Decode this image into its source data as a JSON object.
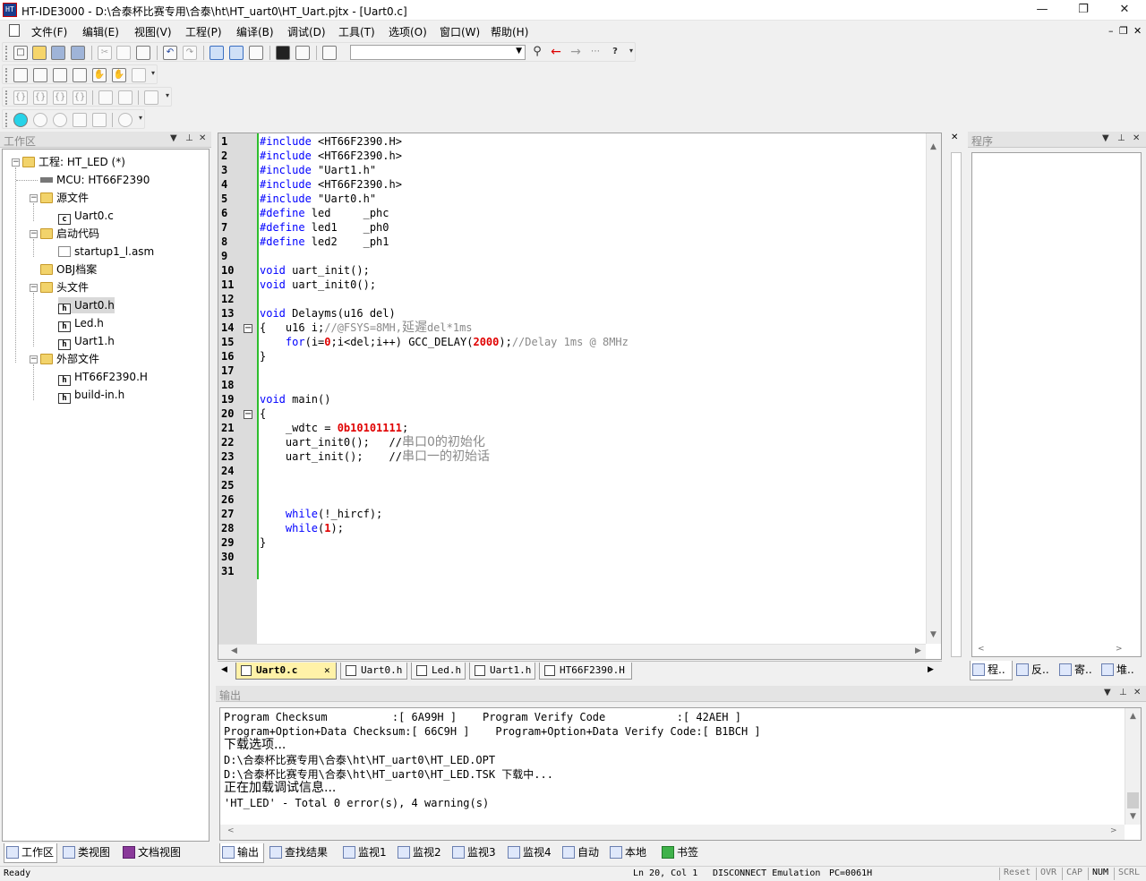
{
  "titlebar": {
    "title": "HT-IDE3000 - D:\\合泰杯比赛专用\\合泰\\ht\\HT_uart0\\HT_Uart.pjtx - [Uart0.c]",
    "icon_text": "HT",
    "minimize": "—",
    "restore": "❐",
    "close": "✕"
  },
  "menubar": {
    "items": [
      "文件(F)",
      "编辑(E)",
      "视图(V)",
      "工程(P)",
      "编译(B)",
      "调试(D)",
      "工具(T)",
      "选项(O)",
      "窗口(W)",
      "帮助(H)"
    ],
    "mdi_controls": [
      "–",
      "❐",
      "✕"
    ]
  },
  "workspace": {
    "header": "工作区",
    "tree": [
      {
        "label": "工程: HT_LED (*)",
        "icon": "project-icon"
      },
      {
        "label": "MCU: HT66F2390",
        "icon": "chip-icon"
      },
      {
        "label": "源文件",
        "icon": "folder-icon"
      },
      {
        "label": "Uart0.c",
        "icon": "c-file-icon"
      },
      {
        "label": "启动代码",
        "icon": "folder-icon"
      },
      {
        "label": "startup1_l.asm",
        "icon": "asm-file-icon"
      },
      {
        "label": "OBJ档案",
        "icon": "folder-icon"
      },
      {
        "label": "头文件",
        "icon": "folder-icon"
      },
      {
        "label": "Uart0.h",
        "icon": "h-file-icon"
      },
      {
        "label": "Led.h",
        "icon": "h-file-icon"
      },
      {
        "label": "Uart1.h",
        "icon": "h-file-icon"
      },
      {
        "label": "外部文件",
        "icon": "folder-icon"
      },
      {
        "label": "HT66F2390.H",
        "icon": "h-file-icon"
      },
      {
        "label": "build-in.h",
        "icon": "h-file-icon"
      }
    ],
    "bottom_tabs": [
      "工作区",
      "类视图",
      "文档视图"
    ]
  },
  "editor": {
    "line_numbers": [
      "1",
      "2",
      "3",
      "4",
      "5",
      "6",
      "7",
      "8",
      "9",
      "10",
      "11",
      "12",
      "13",
      "14",
      "15",
      "16",
      "17",
      "18",
      "19",
      "20",
      "21",
      "22",
      "23",
      "24",
      "25",
      "26",
      "27",
      "28",
      "29",
      "30",
      "31"
    ],
    "tabs": [
      "Uart0.c",
      "Uart0.h",
      "Led.h",
      "Uart1.h",
      "HT66F2390.H"
    ],
    "active_tab": "Uart0.c",
    "code": {
      "l1_kw": "#include",
      "l1_rest": " <HT66F2390.H>",
      "l2_kw": "#include",
      "l2_rest": " <HT66F2390.h>",
      "l3_kw": "#include",
      "l3_rest": " \"Uart1.h\"",
      "l4_kw": "#include",
      "l4_rest": " <HT66F2390.h>",
      "l5_kw": "#include",
      "l5_rest": " \"Uart0.h\"",
      "l6_kw": "#define",
      "l6_rest": " led     _phc",
      "l7_kw": "#define",
      "l7_rest": " led1    _ph0",
      "l8_kw": "#define",
      "l8_rest": " led2    _ph1",
      "l10_kw": "void",
      "l10_rest": " uart_init();",
      "l11_kw": "void",
      "l11_rest": " uart_init0();",
      "l13_kw": "void",
      "l13_rest": " Delayms(u16 del)",
      "l14_pre": "{   u16 i;",
      "l14_cmt": "//@FSYS=8MH,",
      "l14_cmt_cn": "延遲",
      "l14_cmt2": "del*1ms",
      "l15_indent": "    ",
      "l15_kw": "for",
      "l15_a": "(i=",
      "l15_n1": "0",
      "l15_b": ";i<del;i++) GCC_DELAY(",
      "l15_n2": "2000",
      "l15_c": ");",
      "l15_cmt": "//Delay 1ms @ 8MHz",
      "l16": "}",
      "l19_kw": "void",
      "l19_rest": " main()",
      "l20": "{",
      "l21_pre": "    _wdtc = ",
      "l21_num": "0b10101111",
      "l21_post": ";",
      "l22_pre": "    uart_init0();   //",
      "l22_cn": "串口0的初始化",
      "l23_pre": "    uart_init();    //",
      "l23_cn": "串口一的初始话",
      "l27_indent": "    ",
      "l27_kw": "while",
      "l27_rest": "(!_hircf);",
      "l28_indent": "    ",
      "l28_kw": "while",
      "l28_a": "(",
      "l28_num": "1",
      "l28_b": ");",
      "l29": "}"
    }
  },
  "right_panel": {
    "header": "程序",
    "tabs": [
      "程..",
      "反..",
      "寄..",
      "堆.."
    ]
  },
  "output": {
    "header": "输出",
    "lines": [
      {
        "text": "Program Checksum          :[ 6A99H ]    Program Verify Code           :[ 42AEH ]"
      },
      {
        "text": "Program+Option+Data Checksum:[ 66C9H ]    Program+Option+Data Verify Code:[ B1BCH ]"
      },
      {
        "text": "下载选项..."
      },
      {
        "text": "D:\\合泰杯比赛专用\\合泰\\ht\\HT_uart0\\HT_LED.OPT"
      },
      {
        "text": "D:\\合泰杯比赛专用\\合泰\\ht\\HT_uart0\\HT_LED.TSK 下载中..."
      },
      {
        "text": "正在加载调试信息..."
      },
      {
        "text": "'HT_LED' - Total 0 error(s), 4 warning(s)"
      }
    ],
    "tabs": [
      "输出",
      "查找结果",
      "监视1",
      "监视2",
      "监视3",
      "监视4",
      "自动",
      "本地",
      "书签"
    ]
  },
  "statusbar": {
    "ready": "Ready",
    "position": "Ln 20, Col 1",
    "mode": "DISCONNECT Emulation",
    "pc": "PC=0061H",
    "indicators": [
      "Reset",
      "OVR",
      "CAP",
      "NUM",
      "SCRL"
    ]
  },
  "colors": {
    "keyword": "#0000ff",
    "number": "#e00000",
    "comment": "#8a8a8a",
    "change_bar": "#2dbd2d",
    "active_tab": "#fff2a8"
  }
}
